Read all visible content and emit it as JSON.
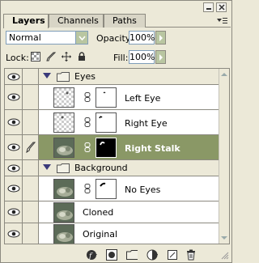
{
  "tabs": [
    {
      "label": "Layers",
      "active": true
    },
    {
      "label": "Channels",
      "active": false
    },
    {
      "label": "Paths",
      "active": false
    }
  ],
  "blend_mode": {
    "value": "Normal"
  },
  "opacity": {
    "label": "Opacity:",
    "value": "100%"
  },
  "lock": {
    "label": "Lock:"
  },
  "fill": {
    "label": "Fill:",
    "value": "100%"
  },
  "layers": [
    {
      "name": "Eyes",
      "kind": "group",
      "expanded": true
    },
    {
      "name": "Left Eye",
      "kind": "layer",
      "thumb": "transparent",
      "mask": "left-eye"
    },
    {
      "name": "Right Eye",
      "kind": "layer",
      "thumb": "transparent",
      "mask": "right-eye"
    },
    {
      "name": "Right Stalk",
      "kind": "layer",
      "thumb": "snail",
      "mask": "stalk",
      "selected": true
    },
    {
      "name": "Background",
      "kind": "group",
      "expanded": true
    },
    {
      "name": "No Eyes",
      "kind": "layer",
      "thumb": "snail",
      "mask": "no-eyes"
    },
    {
      "name": "Cloned",
      "kind": "layer",
      "thumb": "snail"
    },
    {
      "name": "Original",
      "kind": "layer",
      "thumb": "snail"
    }
  ],
  "colors": {
    "selected_row": "#8a9866",
    "panel_bg": "#ece9d8",
    "border": "#8c8a80"
  }
}
